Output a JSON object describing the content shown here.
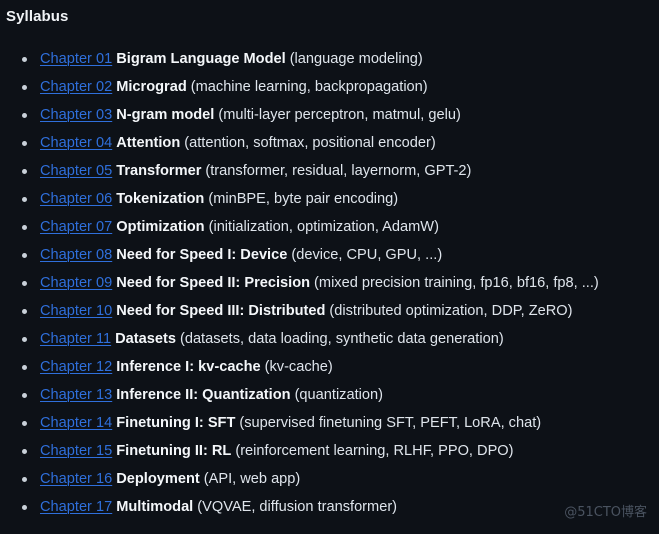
{
  "page": {
    "title": "Syllabus",
    "background_color": "#0d1117",
    "link_color": "#2f6fdb",
    "title_color": "#f4f7fa",
    "desc_color": "#dfe5ec",
    "bullet_color": "#c9d1d9"
  },
  "watermark": {
    "text": "@51CTO博客"
  },
  "syllabus": {
    "items": [
      {
        "link": "Chapter 01",
        "title": "Bigram Language Model",
        "desc": "(language modeling)"
      },
      {
        "link": "Chapter 02",
        "title": "Micrograd",
        "desc": "(machine learning, backpropagation)"
      },
      {
        "link": "Chapter 03",
        "title": "N-gram model",
        "desc": "(multi-layer perceptron, matmul, gelu)"
      },
      {
        "link": "Chapter 04",
        "title": "Attention",
        "desc": "(attention, softmax, positional encoder)"
      },
      {
        "link": "Chapter 05",
        "title": "Transformer",
        "desc": "(transformer, residual, layernorm, GPT-2)"
      },
      {
        "link": "Chapter 06",
        "title": "Tokenization",
        "desc": "(minBPE, byte pair encoding)"
      },
      {
        "link": "Chapter 07",
        "title": "Optimization",
        "desc": "(initialization, optimization, AdamW)"
      },
      {
        "link": "Chapter 08",
        "title": "Need for Speed I: Device",
        "desc": "(device, CPU, GPU, ...)"
      },
      {
        "link": "Chapter 09",
        "title": "Need for Speed II: Precision",
        "desc": "(mixed precision training, fp16, bf16, fp8, ...)"
      },
      {
        "link": "Chapter 10",
        "title": "Need for Speed III: Distributed",
        "desc": "(distributed optimization, DDP, ZeRO)"
      },
      {
        "link": "Chapter 11",
        "title": "Datasets",
        "desc": "(datasets, data loading, synthetic data generation)"
      },
      {
        "link": "Chapter 12",
        "title": "Inference I: kv-cache",
        "desc": "(kv-cache)"
      },
      {
        "link": "Chapter 13",
        "title": "Inference II: Quantization",
        "desc": "(quantization)"
      },
      {
        "link": "Chapter 14",
        "title": "Finetuning I: SFT",
        "desc": "(supervised finetuning SFT, PEFT, LoRA, chat)"
      },
      {
        "link": "Chapter 15",
        "title": "Finetuning II: RL",
        "desc": "(reinforcement learning, RLHF, PPO, DPO)"
      },
      {
        "link": "Chapter 16",
        "title": "Deployment",
        "desc": "(API, web app)"
      },
      {
        "link": "Chapter 17",
        "title": "Multimodal",
        "desc": "(VQVAE, diffusion transformer)"
      }
    ]
  }
}
